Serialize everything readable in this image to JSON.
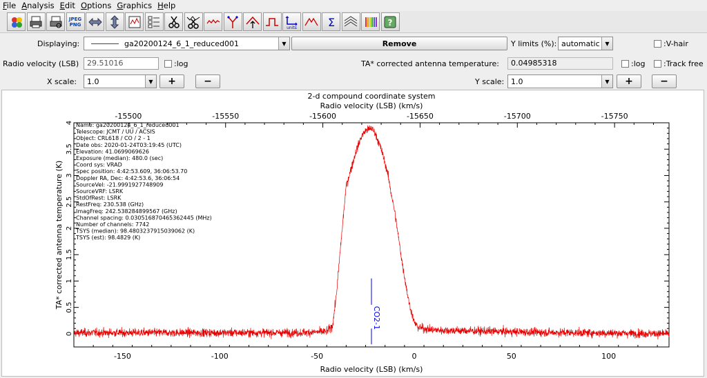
{
  "menu": [
    {
      "label": "File",
      "key": "F",
      "rest": "ile"
    },
    {
      "label": "Analysis",
      "key": "A",
      "rest": "nalysis"
    },
    {
      "label": "Edit",
      "key": "E",
      "rest": "dit"
    },
    {
      "label": "Options",
      "key": "O",
      "rest": "ptions"
    },
    {
      "label": "Graphics",
      "key": "G",
      "rest": "raphics"
    },
    {
      "label": "Help",
      "key": "H",
      "rest": "elp"
    }
  ],
  "toolbar": {
    "icons": [
      "colors-icon",
      "print-icon",
      "print-preview-icon",
      "jpeg-png-icon",
      "horizontal-zoom-icon",
      "vertical-zoom-icon",
      "region-icon",
      "list-icon",
      "cut-icon",
      "cut-spectrum-icon",
      "filter-icon",
      "fork-icon",
      "up-arrow-icon",
      "rectangle-step-icon",
      "units-icon",
      "triangle-icon",
      "sigma-icon",
      "stack-icon",
      "color-bars-icon",
      "help-icon"
    ],
    "jpeg_label": "JPEG PNG",
    "units_label": "units"
  },
  "controls": {
    "displaying_label": "Displaying:",
    "displaying_value": "ga20200124_6_1_reduced001",
    "remove_label": "Remove",
    "ylimits_label": "Y limits (%):",
    "ylimits_value": "automatic",
    "vhair_label": ":V-hair",
    "radio_velocity_label": "Radio velocity (LSB)",
    "radio_velocity_value": "29.51016",
    "log_label": ":log",
    "ta_label": "TA*   corrected antenna temperature:",
    "ta_value": "0.04985318",
    "log2_label": ":log",
    "trackfree_label": ":Track free",
    "xscale_label": "X scale:",
    "xscale_value": "1.0",
    "yscale_label": "Y scale:",
    "yscale_value": "1.0",
    "plus": "+",
    "minus": "−"
  },
  "plot": {
    "title": "2-d compound coordinate system",
    "top_axis_label": "Radio velocity (LSB) (km/s)",
    "bottom_axis_label": "Radio velocity (LSB) (km/s)",
    "y_axis_label": "TA*  corrected antenna temperature (K)",
    "line_id_label": "CO2-1",
    "line_id_velocity": -22,
    "color": "#e60000",
    "line_id_color": "#0000ee",
    "info_lines": [
      "Name: ga20200124_6_1_reduced001",
      "Telescope: JCMT / UU / ACSIS",
      "Object: CRL618 / CO / 2 - 1",
      "Date obs: 2020-01-24T03:19:45 (UTC)",
      "Elevation: 41.0699069626",
      "Exposure (median): 480.0 (sec)",
      "Coord sys: VRAD",
      "Spec position: 4:42:53.609, 36:06:53.70",
      "Doppler RA, Dec: 4:42:53.6, 36:06:54",
      "SourceVel: -21.9991927748909",
      "SourceVRF: LSRK",
      "StdOfRest: LSRK",
      "RestFreq: 230.538 (GHz)",
      "ImagFreq: 242.538284899567 (GHz)",
      "Channel spacing: 0.030516870465362445 (MHz)",
      "Number of channels: 7742",
      "TSYS (median): 98.4803237915039062 (K)",
      "TSYS (est): 98.4829 (K)"
    ]
  },
  "chart_data": {
    "type": "line",
    "title": "2-d compound coordinate system",
    "xlabel": "Radio velocity (LSB) (km/s)",
    "ylabel": "TA*  corrected antenna temperature (K)",
    "xlim": [
      -175,
      131
    ],
    "ylim": [
      -0.25,
      4.0
    ],
    "top_xlim": [
      -15472,
      -15778
    ],
    "x_ticks": [
      -150,
      -100,
      -50,
      0,
      50,
      100
    ],
    "top_x_ticks": [
      -15500,
      -15550,
      -15600,
      -15650,
      -15700,
      -15750
    ],
    "y_ticks": [
      0,
      0.5,
      1,
      1.5,
      2,
      2.5,
      3,
      3.5,
      4
    ],
    "y_tick_labels": [
      "0",
      "0.5",
      "1",
      "1.5",
      "2",
      "2.5",
      "3",
      "3.5",
      "4"
    ],
    "noise_level": 0.1,
    "series": [
      {
        "x": [
          -175,
          -60,
          -45,
          -42,
          -40,
          -38,
          -35,
          -30,
          -27,
          -25,
          -23,
          -22,
          -20,
          -17,
          -14,
          -10,
          -6,
          -3,
          -1,
          0,
          2,
          10,
          60,
          131
        ],
        "y": [
          0.02,
          0.02,
          0.04,
          0.15,
          0.75,
          1.6,
          2.8,
          3.45,
          3.75,
          3.85,
          3.88,
          3.9,
          3.8,
          3.5,
          3.1,
          2.3,
          1.3,
          0.65,
          0.35,
          0.22,
          0.12,
          0.07,
          0.03,
          0.0
        ]
      }
    ]
  }
}
